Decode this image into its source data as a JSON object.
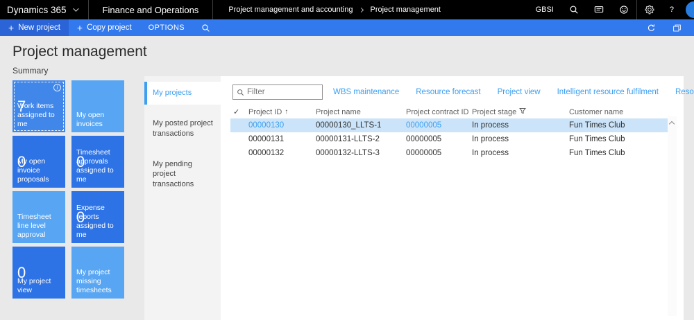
{
  "topnav": {
    "brand": "Dynamics 365",
    "app_name": "Finance and Operations",
    "breadcrumb_parent": "Project management and accounting",
    "breadcrumb_current": "Project management",
    "company_badge": "GBSI"
  },
  "actionbar": {
    "new_project": "New project",
    "copy_project": "Copy project",
    "options": "OPTIONS"
  },
  "page": {
    "title": "Project management",
    "section_label": "Summary"
  },
  "tiles": [
    {
      "count": "7",
      "label": "Work items assigned to me"
    },
    {
      "count": "",
      "label": "My open invoices"
    },
    {
      "count": "0",
      "label": "My open invoice proposals"
    },
    {
      "count": "0",
      "label": "Timesheet approvals assigned to me"
    },
    {
      "count": "",
      "label": "Timesheet line level approval"
    },
    {
      "count": "0",
      "label": "Expense reports assigned to me"
    },
    {
      "count": "0",
      "label": "My project view"
    },
    {
      "count": "",
      "label": "My project missing timesheets"
    }
  ],
  "tabs": [
    {
      "label": "My projects"
    },
    {
      "label": "My posted project transactions"
    },
    {
      "label": "My pending project transactions"
    }
  ],
  "filter": {
    "placeholder": "Filter"
  },
  "quick_links": [
    "WBS maintenance",
    "Resource forecast",
    "Project view",
    "Intelligent resource fulfilment",
    "Resource view"
  ],
  "grid": {
    "headers": {
      "project_id": "Project ID",
      "project_name": "Project name",
      "project_contract_id": "Project contract ID",
      "project_stage": "Project stage",
      "customer_name": "Customer name"
    },
    "rows": [
      {
        "project_id": "00000130",
        "project_name": "00000130_LLTS-1",
        "project_contract_id": "00000005",
        "project_stage": "In process",
        "customer_name": "Fun Times Club",
        "selected": true
      },
      {
        "project_id": "00000131",
        "project_name": "00000131-LLTS-2",
        "project_contract_id": "00000005",
        "project_stage": "In process",
        "customer_name": "Fun Times Club",
        "selected": false
      },
      {
        "project_id": "00000132",
        "project_name": "00000132-LLTS-3",
        "project_contract_id": "00000005",
        "project_stage": "In process",
        "customer_name": "Fun Times Club",
        "selected": false
      }
    ]
  },
  "icons": {
    "plus": "+",
    "help": "?",
    "check": "✓",
    "sort_asc": "↑",
    "search": "magnifier",
    "feedback": "chat-bubble",
    "sentiment": "smiley-face",
    "settings": "gear",
    "refresh": "circular-arrow",
    "popout": "new-window",
    "filter_funnel": "funnel",
    "info": "i"
  },
  "colors": {
    "topnav_bg": "#000000",
    "actionbar_bg": "#3379ee",
    "actionbar_active_bg": "#2a64d6",
    "tile_dark": "#2e73e5",
    "tile_light": "#58a6f3",
    "tile_focused": "#4187ea",
    "accent_link_blue": "#3b9ff2",
    "selected_row_bg": "#cbe4f9",
    "page_bg": "#e9e9e9",
    "tabstrip_bg": "#f3f3f3"
  }
}
